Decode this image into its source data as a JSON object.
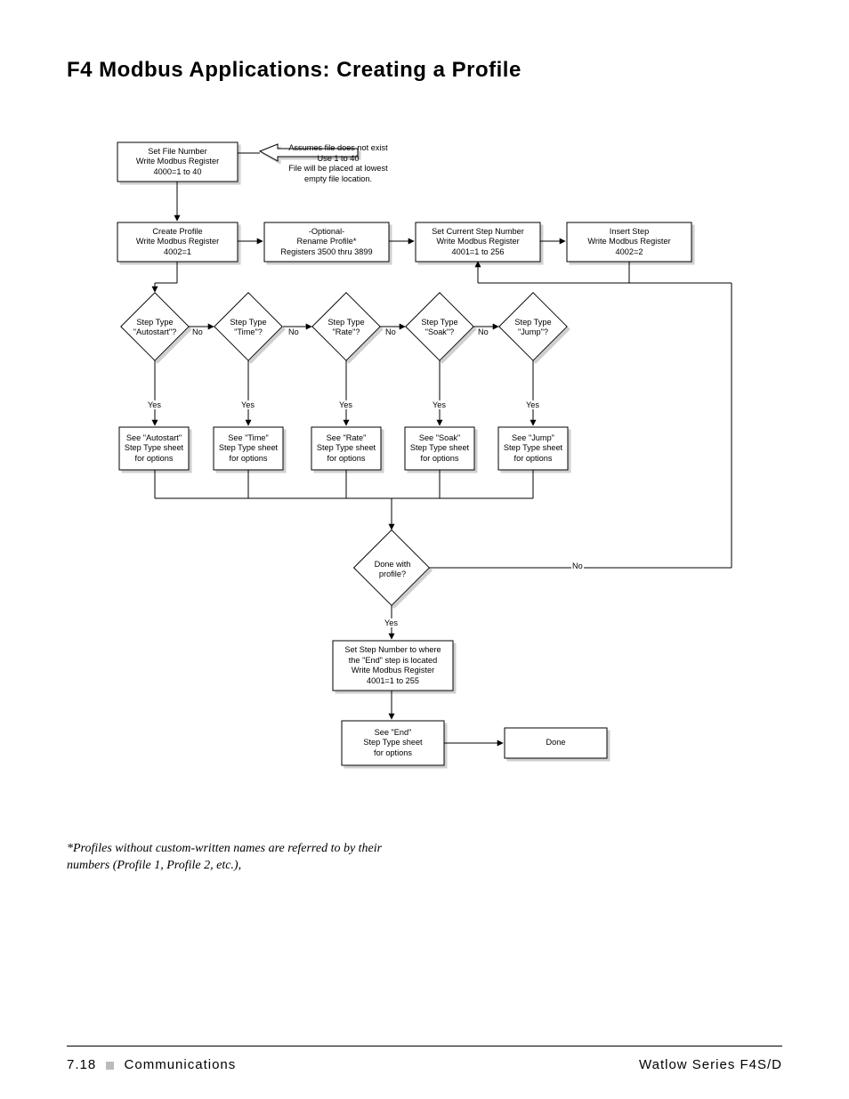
{
  "title": "F4 Modbus Applications:  Creating a Profile",
  "boxes": {
    "setfile": {
      "l1": "Set File Number",
      "l2": "Write Modbus Register",
      "l3": "4000=1 to 40"
    },
    "assumes": {
      "l1": "Assumes file does not exist",
      "l2": "Use 1 to 40",
      "l3": "File will be placed at lowest",
      "l4": "empty file location."
    },
    "create": {
      "l1": "Create Profile",
      "l2": "Write Modbus Register",
      "l3": "4002=1"
    },
    "optional": {
      "l1": "-Optional-",
      "l2": "Rename Profile*",
      "l3": "Registers 3500 thru 3899"
    },
    "setcur": {
      "l1": "Set Current Step Number",
      "l2": "Write Modbus Register",
      "l3": "4001=1 to 256"
    },
    "insert": {
      "l1": "Insert Step",
      "l2": "Write Modbus Register",
      "l3": "4002=2"
    },
    "d_autostart": {
      "l1": "Step Type",
      "l2": "\"Autostart\"?"
    },
    "d_time": {
      "l1": "Step Type",
      "l2": "\"Time\"?"
    },
    "d_rate": {
      "l1": "Step Type",
      "l2": "\"Rate\"?"
    },
    "d_soak": {
      "l1": "Step Type",
      "l2": "\"Soak\"?"
    },
    "d_jump": {
      "l1": "Step Type",
      "l2": "\"Jump\"?"
    },
    "see_auto": {
      "l1": "See \"Autostart\"",
      "l2": "Step Type sheet",
      "l3": "for options"
    },
    "see_time": {
      "l1": "See \"Time\"",
      "l2": "Step Type sheet",
      "l3": "for options"
    },
    "see_rate": {
      "l1": "See \"Rate\"",
      "l2": "Step Type sheet",
      "l3": "for options"
    },
    "see_soak": {
      "l1": "See \"Soak\"",
      "l2": "Step Type sheet",
      "l3": "for options"
    },
    "see_jump": {
      "l1": "See \"Jump\"",
      "l2": "Step Type sheet",
      "l3": "for options"
    },
    "d_done": {
      "l1": "Done with",
      "l2": "profile?"
    },
    "setstep": {
      "l1": "Set Step Number to where",
      "l2": "the \"End\" step is located",
      "l3": "Write Modbus Register",
      "l4": "4001=1 to 255"
    },
    "see_end": {
      "l1": "See \"End\"",
      "l2": "Step Type sheet",
      "l3": "for options"
    },
    "done": {
      "l1": "Done"
    }
  },
  "labels": {
    "yes": "Yes",
    "no": "No"
  },
  "footnote": "*Profiles without custom-written names are referred to by their numbers (Profile 1, Profile 2, etc.),",
  "footer": {
    "page": "7.18",
    "section": "Communications",
    "right": "Watlow Series F4S/D"
  }
}
